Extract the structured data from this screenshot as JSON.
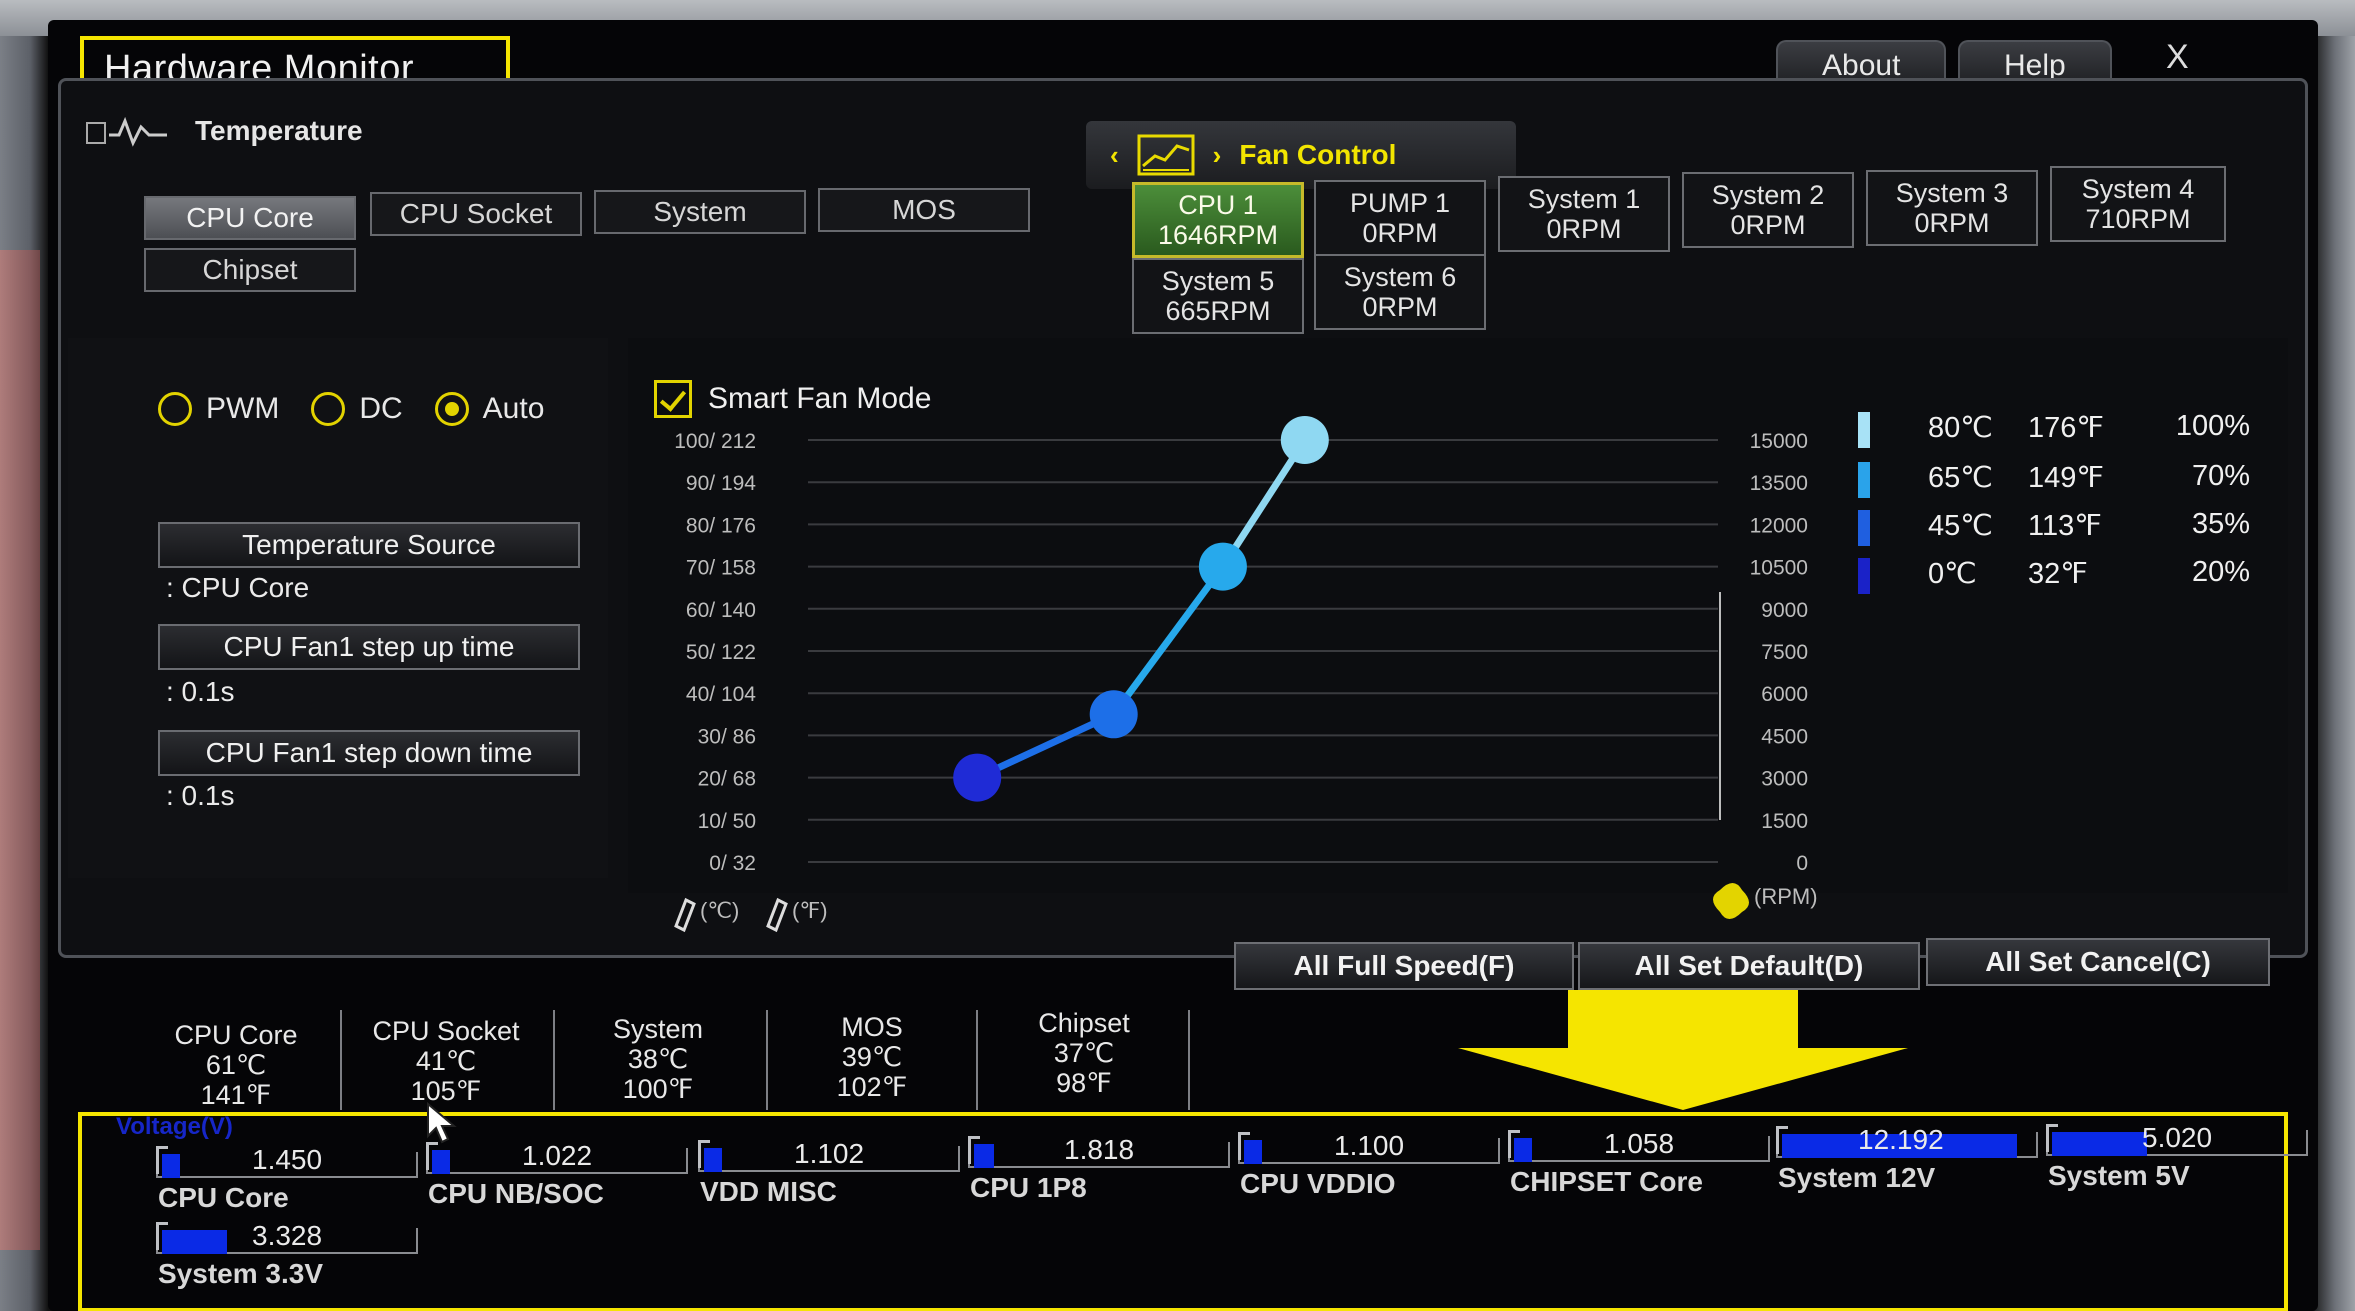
{
  "window": {
    "title": "Hardware Monitor",
    "about_label": "About",
    "help_label": "Help",
    "close_label": "X"
  },
  "temperature": {
    "header": "Temperature",
    "sources": [
      "CPU Core",
      "CPU Socket",
      "System",
      "MOS",
      "Chipset"
    ],
    "selected": "CPU Core"
  },
  "fan_control": {
    "header": "Fan Control",
    "fans": [
      {
        "name": "CPU 1",
        "rpm": "1646RPM",
        "active": true
      },
      {
        "name": "PUMP 1",
        "rpm": "0RPM"
      },
      {
        "name": "System 1",
        "rpm": "0RPM"
      },
      {
        "name": "System 2",
        "rpm": "0RPM"
      },
      {
        "name": "System 3",
        "rpm": "0RPM"
      },
      {
        "name": "System 4",
        "rpm": "710RPM"
      },
      {
        "name": "System 5",
        "rpm": "665RPM"
      },
      {
        "name": "System 6",
        "rpm": "0RPM"
      }
    ]
  },
  "mode": {
    "pwm_label": "PWM",
    "dc_label": "DC",
    "auto_label": "Auto",
    "selected": "Auto",
    "temp_source_label": "Temperature Source",
    "temp_source_value": ": CPU Core",
    "step_up_label": "CPU Fan1 step up time",
    "step_up_value": ": 0.1s",
    "step_down_label": "CPU Fan1 step down time",
    "step_down_value": ": 0.1s"
  },
  "smart_fan": {
    "label": "Smart Fan Mode",
    "checked": true
  },
  "chart_data": {
    "type": "line",
    "title": "",
    "xlabel": "",
    "y_left_ticks": [
      "100/ 212",
      "90/ 194",
      "80/ 176",
      "70/ 158",
      "60/ 140",
      "50/ 122",
      "40/ 104",
      "30/  86",
      "20/  68",
      "10/  50",
      "0/  32"
    ],
    "y_right_ticks": [
      "15000",
      "13500",
      "12000",
      "10500",
      "9000",
      "7500",
      "6000",
      "4500",
      "3000",
      "1500",
      "0"
    ],
    "left_unit_c": "(℃)",
    "left_unit_f": "(℉)",
    "right_unit": "(RPM)",
    "ylim": [
      0,
      100
    ],
    "points": [
      {
        "temp_pct": 20,
        "fan_pct": 20
      },
      {
        "temp_pct": 45,
        "fan_pct": 35
      },
      {
        "temp_pct": 65,
        "fan_pct": 70
      },
      {
        "temp_pct": 80,
        "fan_pct": 100
      }
    ],
    "point_colors": [
      "#1f2bd6",
      "#1d6fe8",
      "#27a9ec",
      "#8fd8f2"
    ],
    "legend": [
      {
        "c": "80℃",
        "f": "176℉",
        "p": "100%",
        "color": "#a8e2f6"
      },
      {
        "c": "65℃",
        "f": "149℉",
        "p": "70%",
        "color": "#2aa3ea"
      },
      {
        "c": "45℃",
        "f": "113℉",
        "p": "35%",
        "color": "#1f5fe0"
      },
      {
        "c": "0℃",
        "f": "32℉",
        "p": "20%",
        "color": "#1a22c8"
      }
    ]
  },
  "actions": {
    "full_speed": "All Full Speed(F)",
    "set_default": "All Set Default(D)",
    "set_cancel": "All Set Cancel(C)"
  },
  "temp_summary": [
    {
      "name": "CPU Core",
      "c": "61℃",
      "f": "141℉"
    },
    {
      "name": "CPU Socket",
      "c": "41℃",
      "f": "105℉"
    },
    {
      "name": "System",
      "c": "38℃",
      "f": "100℉"
    },
    {
      "name": "MOS",
      "c": "39℃",
      "f": "102℉"
    },
    {
      "name": "Chipset",
      "c": "37℃",
      "f": "98℉"
    }
  ],
  "voltage": {
    "title": "Voltage(V)",
    "items": [
      {
        "name": "CPU Core",
        "value": "1.450",
        "level": 0.06
      },
      {
        "name": "CPU NB/SOC",
        "value": "1.022",
        "level": 0.05
      },
      {
        "name": "VDD MISC",
        "value": "1.102",
        "level": 0.05
      },
      {
        "name": "CPU 1P8",
        "value": "1.818",
        "level": 0.08
      },
      {
        "name": "CPU VDDIO",
        "value": "1.100",
        "level": 0.05
      },
      {
        "name": "CHIPSET Core",
        "value": "1.058",
        "level": 0.05
      },
      {
        "name": "System 12V",
        "value": "12.192",
        "level": 0.94
      },
      {
        "name": "System 5V",
        "value": "5.020",
        "level": 0.38
      },
      {
        "name": "System 3.3V",
        "value": "3.328",
        "level": 0.26
      }
    ]
  },
  "colors": {
    "highlight": "#f5e500",
    "accent": "#e3d400",
    "voltage_bar": "#0a2ae6"
  }
}
